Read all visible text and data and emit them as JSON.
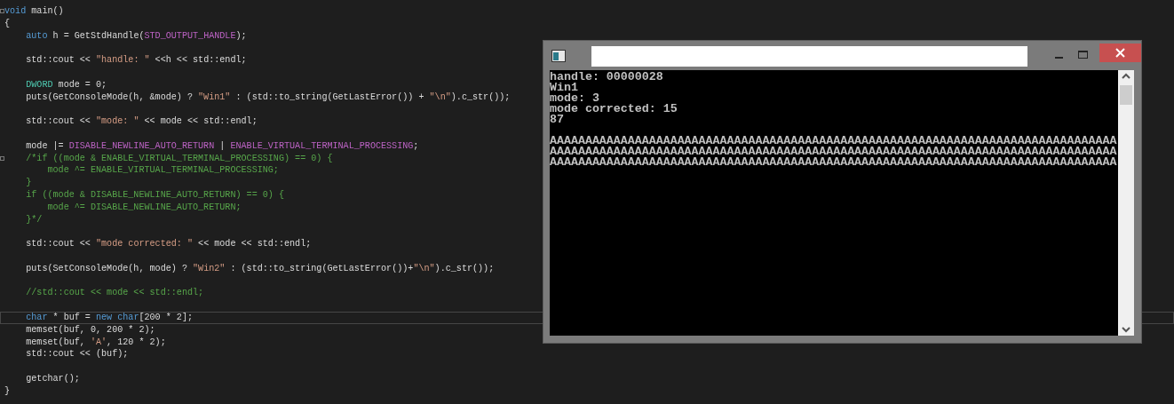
{
  "editor": {
    "lines": [
      {
        "kind": "code",
        "foldable": true,
        "current": false,
        "tokens": [
          {
            "kind": "keyword",
            "text": "void"
          },
          {
            "kind": "plain",
            "text": " main()"
          }
        ]
      },
      {
        "kind": "code",
        "foldable": false,
        "current": false,
        "tokens": [
          {
            "kind": "plain",
            "text": "{"
          }
        ]
      },
      {
        "kind": "code",
        "foldable": false,
        "current": false,
        "tokens": [
          {
            "kind": "keyword",
            "text": "    auto"
          },
          {
            "kind": "plain",
            "text": " h = GetStdHandle("
          },
          {
            "kind": "macro",
            "text": "STD_OUTPUT_HANDLE"
          },
          {
            "kind": "plain",
            "text": ");"
          }
        ]
      },
      {
        "kind": "blank",
        "foldable": false,
        "current": false
      },
      {
        "kind": "code",
        "foldable": false,
        "current": false,
        "tokens": [
          {
            "kind": "plain",
            "text": "    std::cout << "
          },
          {
            "kind": "string",
            "text": "\"handle: \""
          },
          {
            "kind": "plain",
            "text": " <<h << std::endl;"
          }
        ]
      },
      {
        "kind": "blank",
        "foldable": false,
        "current": false
      },
      {
        "kind": "code",
        "foldable": false,
        "current": false,
        "tokens": [
          {
            "kind": "type",
            "text": "    DWORD"
          },
          {
            "kind": "plain",
            "text": " mode = 0;"
          }
        ]
      },
      {
        "kind": "code",
        "foldable": false,
        "current": false,
        "tokens": [
          {
            "kind": "plain",
            "text": "    puts(GetConsoleMode(h, &mode) ? "
          },
          {
            "kind": "string",
            "text": "\"Win1\""
          },
          {
            "kind": "plain",
            "text": " : (std::to_string(GetLastError()) + "
          },
          {
            "kind": "string",
            "text": "\"\\n\""
          },
          {
            "kind": "plain",
            "text": ").c_str());"
          }
        ]
      },
      {
        "kind": "blank",
        "foldable": false,
        "current": false
      },
      {
        "kind": "code",
        "foldable": false,
        "current": false,
        "tokens": [
          {
            "kind": "plain",
            "text": "    std::cout << "
          },
          {
            "kind": "string",
            "text": "\"mode: \""
          },
          {
            "kind": "plain",
            "text": " << mode << std::endl;"
          }
        ]
      },
      {
        "kind": "blank",
        "foldable": false,
        "current": false
      },
      {
        "kind": "code",
        "foldable": false,
        "current": false,
        "tokens": [
          {
            "kind": "plain",
            "text": "    mode |= "
          },
          {
            "kind": "macro",
            "text": "DISABLE_NEWLINE_AUTO_RETURN"
          },
          {
            "kind": "plain",
            "text": " | "
          },
          {
            "kind": "macro",
            "text": "ENABLE_VIRTUAL_TERMINAL_PROCESSING"
          },
          {
            "kind": "plain",
            "text": ";"
          }
        ]
      },
      {
        "kind": "code",
        "foldable": true,
        "current": false,
        "tokens": [
          {
            "kind": "comment",
            "text": "    /*if ((mode & ENABLE_VIRTUAL_TERMINAL_PROCESSING) == 0) {"
          }
        ]
      },
      {
        "kind": "code",
        "foldable": false,
        "current": false,
        "tokens": [
          {
            "kind": "comment",
            "text": "        mode ^= ENABLE_VIRTUAL_TERMINAL_PROCESSING;"
          }
        ]
      },
      {
        "kind": "code",
        "foldable": false,
        "current": false,
        "tokens": [
          {
            "kind": "comment",
            "text": "    }"
          }
        ]
      },
      {
        "kind": "code",
        "foldable": false,
        "current": false,
        "tokens": [
          {
            "kind": "comment",
            "text": "    if ((mode & DISABLE_NEWLINE_AUTO_RETURN) == 0) {"
          }
        ]
      },
      {
        "kind": "code",
        "foldable": false,
        "current": false,
        "tokens": [
          {
            "kind": "comment",
            "text": "        mode ^= DISABLE_NEWLINE_AUTO_RETURN;"
          }
        ]
      },
      {
        "kind": "code",
        "foldable": false,
        "current": false,
        "tokens": [
          {
            "kind": "comment",
            "text": "    }*/"
          }
        ]
      },
      {
        "kind": "blank",
        "foldable": false,
        "current": false
      },
      {
        "kind": "code",
        "foldable": false,
        "current": false,
        "tokens": [
          {
            "kind": "plain",
            "text": "    std::cout << "
          },
          {
            "kind": "string",
            "text": "\"mode corrected: \""
          },
          {
            "kind": "plain",
            "text": " << mode << std::endl;"
          }
        ]
      },
      {
        "kind": "blank",
        "foldable": false,
        "current": false
      },
      {
        "kind": "code",
        "foldable": false,
        "current": false,
        "tokens": [
          {
            "kind": "plain",
            "text": "    puts(SetConsoleMode(h, mode) ? "
          },
          {
            "kind": "string",
            "text": "\"Win2\""
          },
          {
            "kind": "plain",
            "text": " : (std::to_string(GetLastError())+"
          },
          {
            "kind": "string",
            "text": "\"\\n\""
          },
          {
            "kind": "plain",
            "text": ").c_str());"
          }
        ]
      },
      {
        "kind": "blank",
        "foldable": false,
        "current": false
      },
      {
        "kind": "code",
        "foldable": false,
        "current": false,
        "tokens": [
          {
            "kind": "comment",
            "text": "    //std::cout << mode << std::endl;"
          }
        ]
      },
      {
        "kind": "blank",
        "foldable": false,
        "current": false
      },
      {
        "kind": "code",
        "foldable": false,
        "current": true,
        "tokens": [
          {
            "kind": "keyword",
            "text": "    char"
          },
          {
            "kind": "plain",
            "text": " * buf = "
          },
          {
            "kind": "keyword",
            "text": "new char"
          },
          {
            "kind": "plain",
            "text": "[200 * 2];"
          }
        ]
      },
      {
        "kind": "code",
        "foldable": false,
        "current": false,
        "tokens": [
          {
            "kind": "plain",
            "text": "    memset(buf, 0, 200 * 2);"
          }
        ]
      },
      {
        "kind": "code",
        "foldable": false,
        "current": false,
        "tokens": [
          {
            "kind": "plain",
            "text": "    memset(buf, "
          },
          {
            "kind": "string",
            "text": "'A'"
          },
          {
            "kind": "plain",
            "text": ", 120 * 2);"
          }
        ]
      },
      {
        "kind": "code",
        "foldable": false,
        "current": false,
        "tokens": [
          {
            "kind": "plain",
            "text": "    std::cout << (buf);"
          }
        ]
      },
      {
        "kind": "blank",
        "foldable": false,
        "current": false
      },
      {
        "kind": "code",
        "foldable": false,
        "current": false,
        "tokens": [
          {
            "kind": "plain",
            "text": "    getchar();"
          }
        ]
      },
      {
        "kind": "code",
        "foldable": false,
        "current": false,
        "tokens": [
          {
            "kind": "plain",
            "text": "}"
          }
        ]
      }
    ]
  },
  "console": {
    "lines": [
      {
        "kind": "text",
        "text": "handle: 00000028"
      },
      {
        "kind": "text",
        "text": "Win1"
      },
      {
        "kind": "text",
        "text": "mode: 3"
      },
      {
        "kind": "text",
        "text": "mode corrected: 15"
      },
      {
        "kind": "text",
        "text": "87"
      },
      {
        "kind": "blank"
      },
      {
        "kind": "text",
        "text": "AAAAAAAAAAAAAAAAAAAAAAAAAAAAAAAAAAAAAAAAAAAAAAAAAAAAAAAAAAAAAAAAAAAAAAAAAAAAAAAA"
      },
      {
        "kind": "text",
        "text": "AAAAAAAAAAAAAAAAAAAAAAAAAAAAAAAAAAAAAAAAAAAAAAAAAAAAAAAAAAAAAAAAAAAAAAAAAAAAAAAA"
      },
      {
        "kind": "text",
        "text": "AAAAAAAAAAAAAAAAAAAAAAAAAAAAAAAAAAAAAAAAAAAAAAAAAAAAAAAAAAAAAAAAAAAAAAAAAAAAAAAA"
      }
    ]
  }
}
